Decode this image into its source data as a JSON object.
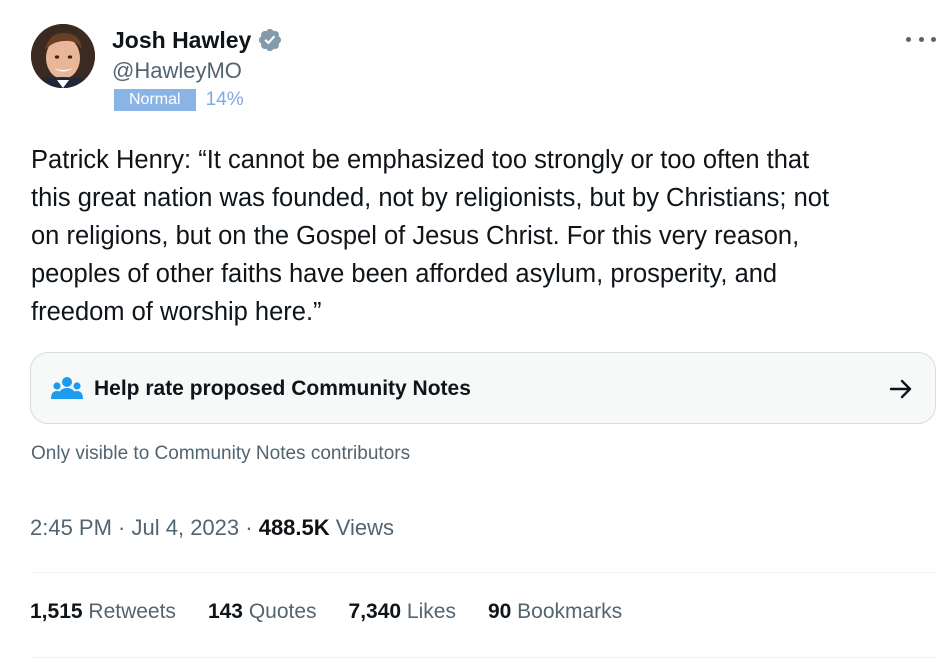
{
  "author": {
    "display_name": "Josh Hawley",
    "handle": "@HawleyMO",
    "verified_color": "#829aab"
  },
  "label": {
    "badge": "Normal",
    "percent": "14%",
    "badge_color": "#8ab4e6"
  },
  "tweet": {
    "text": "Patrick Henry: “It cannot be emphasized too strongly or too often that\nthis great nation was founded, not by religionists, but by Christians; not\non religions, but on the Gospel of Jesus Christ. For this very reason,\npeoples of other faiths have been afforded asylum, prosperity, and\nfreedom of worship here.”"
  },
  "community_notes": {
    "title": "Help rate proposed Community Notes",
    "visibility": "Only visible to Community Notes contributors",
    "icon": "people-icon",
    "action_icon": "arrow-right-icon"
  },
  "meta": {
    "time": "2:45 PM",
    "sep1": " · ",
    "date": "Jul 4, 2023",
    "sep2": " · ",
    "views_count": "488.5K",
    "views_label": " Views"
  },
  "stats": [
    {
      "count": "1,515",
      "label": " Retweets"
    },
    {
      "count": "143",
      "label": " Quotes"
    },
    {
      "count": "7,340",
      "label": " Likes"
    },
    {
      "count": "90",
      "label": " Bookmarks"
    }
  ],
  "colors": {
    "text": "#0f1419",
    "secondary": "#536471",
    "card_bg": "#f7f9f9",
    "icon_blue": "#1d9bf0"
  }
}
